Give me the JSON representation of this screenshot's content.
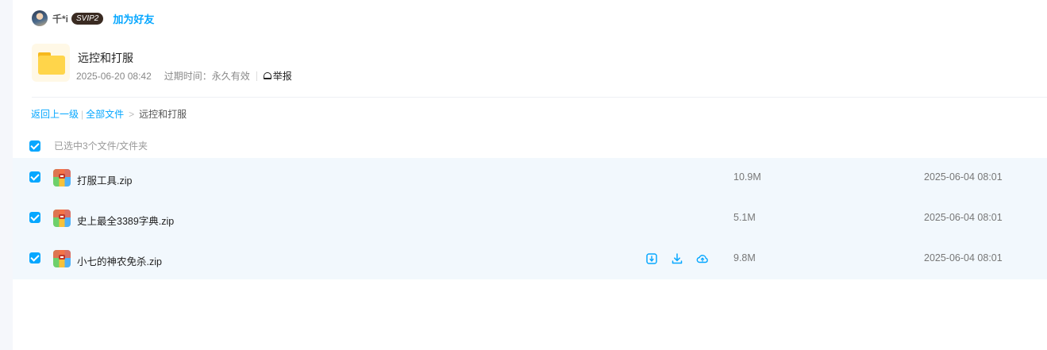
{
  "owner": {
    "name": "千*i",
    "badge": "SVIP2",
    "add_friend": "加为好友"
  },
  "share": {
    "title": "远控和打服",
    "date": "2025-06-20 08:42",
    "expiry": "过期时间：永久有效",
    "report": "举报"
  },
  "breadcrumb": {
    "back": "返回上一级",
    "sep": "|",
    "all_files": "全部文件",
    "gt": ">",
    "current": "远控和打服"
  },
  "selection": {
    "label": "已选中3个文件/文件夹"
  },
  "files": [
    {
      "name": "打服工具.zip",
      "size": "10.9M",
      "date": "2025-06-04 08:01"
    },
    {
      "name": "史上最全3389字典.zip",
      "size": "5.1M",
      "date": "2025-06-04 08:01"
    },
    {
      "name": "小七的神农免杀.zip",
      "size": "9.8M",
      "date": "2025-06-04 08:01"
    }
  ],
  "row_actions": [
    "save-to-netdisk-icon",
    "download-icon",
    "cloud-upload-icon"
  ],
  "colors": {
    "accent": "#06a7ff",
    "row_bg": "#f2f8fd"
  }
}
